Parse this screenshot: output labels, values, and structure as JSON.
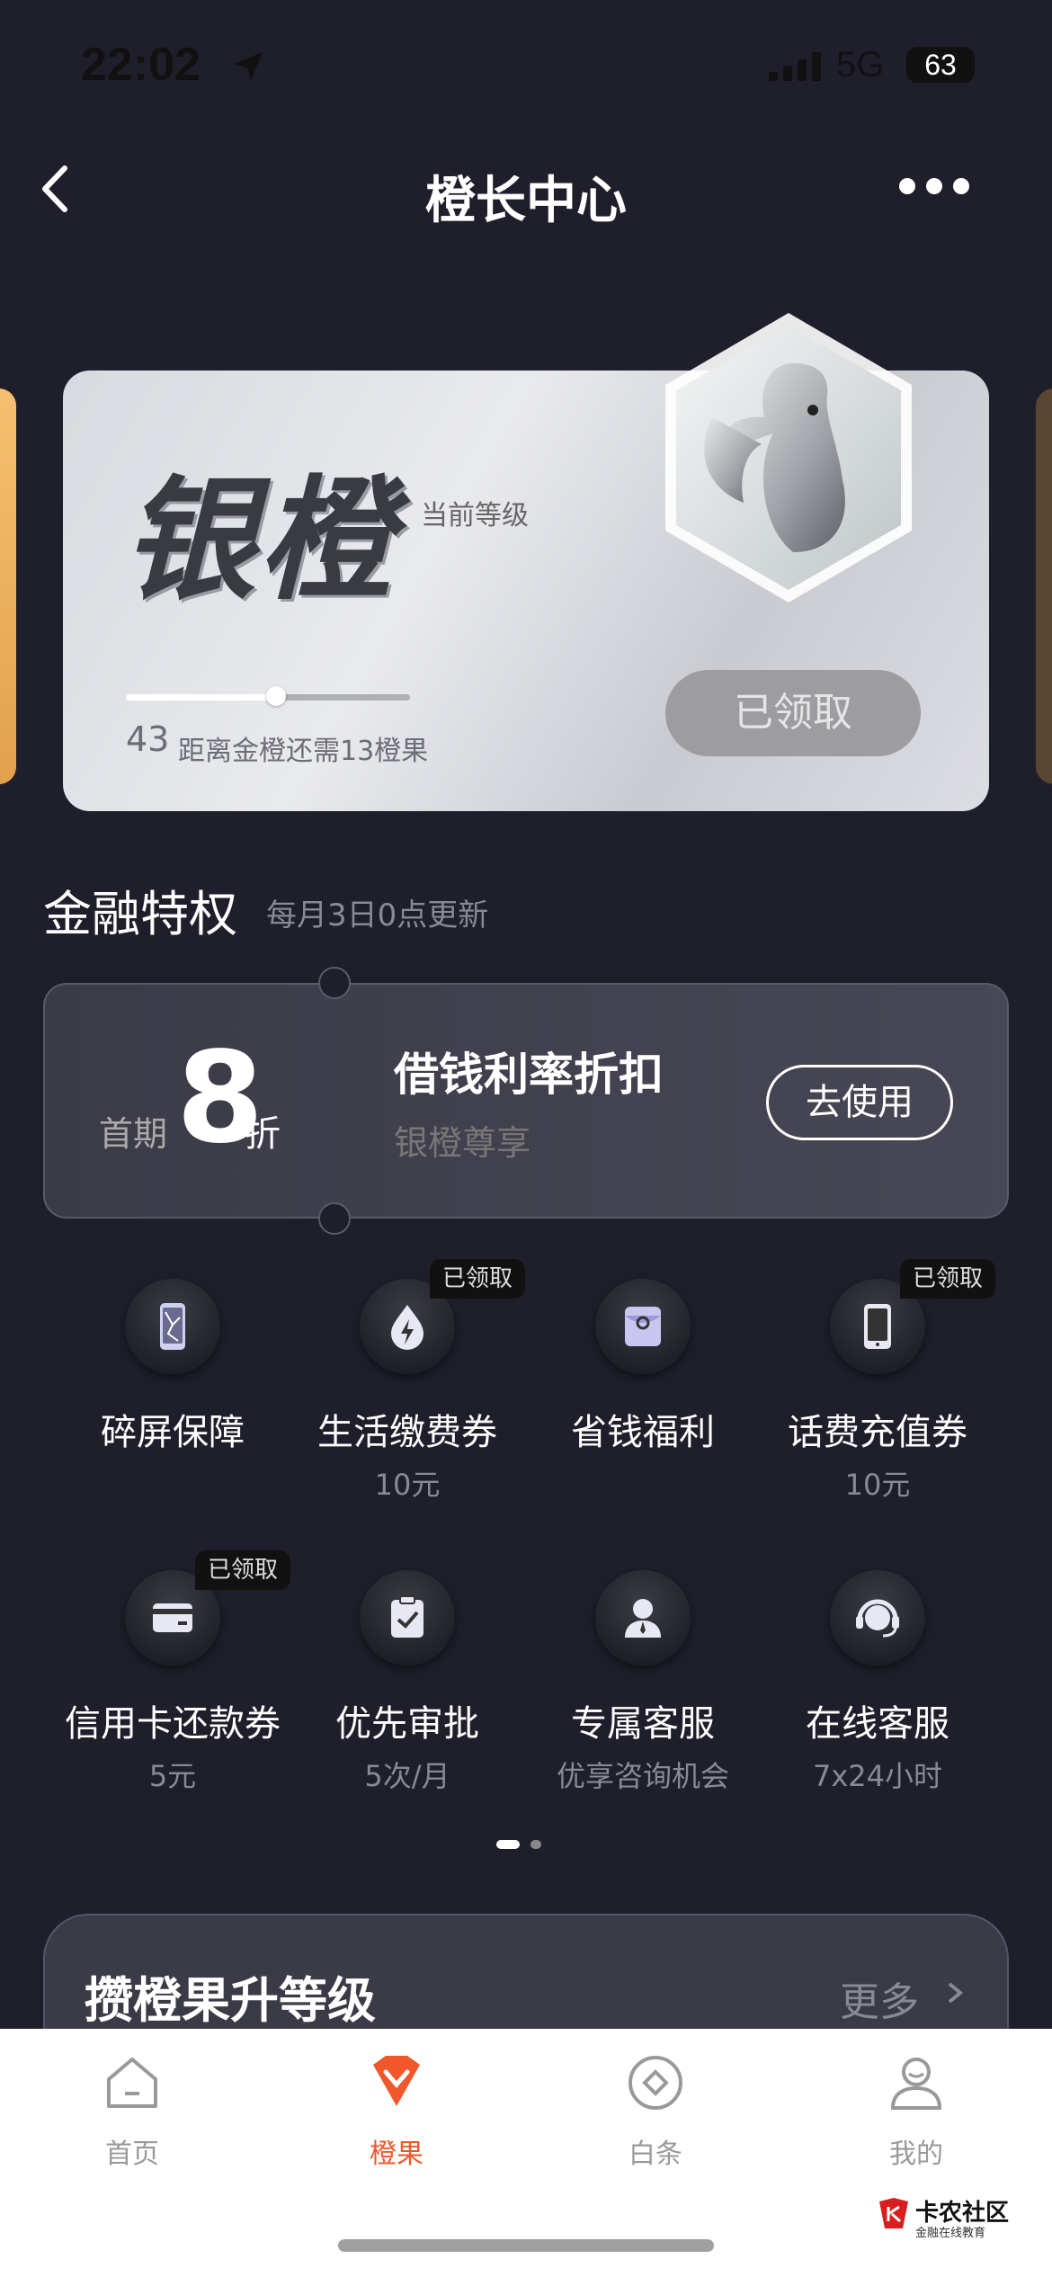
{
  "status": {
    "time": "22:02",
    "network": "5G",
    "battery": "63"
  },
  "nav": {
    "title": "橙长中心"
  },
  "level_card": {
    "level_name": "银橙",
    "caption": "当前等级",
    "points": "43",
    "points_note": "距离金橙还需13橙果",
    "progress": 0.53,
    "button": "已领取"
  },
  "finance": {
    "title": "金融特权",
    "subtitle": "每月3日0点更新",
    "coupon": {
      "prefix": "首期",
      "value": "8",
      "unit": "折",
      "title": "借钱利率折扣",
      "subtitle": "银橙尊享",
      "button": "去使用"
    },
    "benefits": [
      {
        "label": "碎屏保障",
        "sub": "",
        "tag": "",
        "icon": "cracked-phone-icon"
      },
      {
        "label": "生活缴费券",
        "sub": "10元",
        "tag": "已领取",
        "icon": "utility-bolt-icon"
      },
      {
        "label": "省钱福利",
        "sub": "",
        "tag": "",
        "icon": "red-envelope-icon"
      },
      {
        "label": "话费充值券",
        "sub": "10元",
        "tag": "已领取",
        "icon": "phone-icon"
      },
      {
        "label": "信用卡还款券",
        "sub": "5元",
        "tag": "已领取",
        "icon": "credit-card-icon"
      },
      {
        "label": "优先审批",
        "sub": "5次/月",
        "tag": "",
        "icon": "clipboard-check-icon"
      },
      {
        "label": "专属客服",
        "sub": "优享咨询机会",
        "tag": "",
        "icon": "agent-icon"
      },
      {
        "label": "在线客服",
        "sub": "7x24小时",
        "tag": "",
        "icon": "headset-icon"
      }
    ]
  },
  "upgrade": {
    "title": "攒橙果升等级",
    "more": "更多"
  },
  "tabs": [
    {
      "label": "首页",
      "icon": "home-icon",
      "active": false
    },
    {
      "label": "橙果",
      "icon": "orange-diamond-icon",
      "active": true
    },
    {
      "label": "白条",
      "icon": "baitiao-icon",
      "active": false
    },
    {
      "label": "我的",
      "icon": "profile-icon",
      "active": false
    }
  ],
  "watermark": {
    "title": "卡农社区",
    "subtitle": "金融在线教育"
  },
  "colors": {
    "accent": "#f0582b",
    "background": "#1f1f2b"
  }
}
